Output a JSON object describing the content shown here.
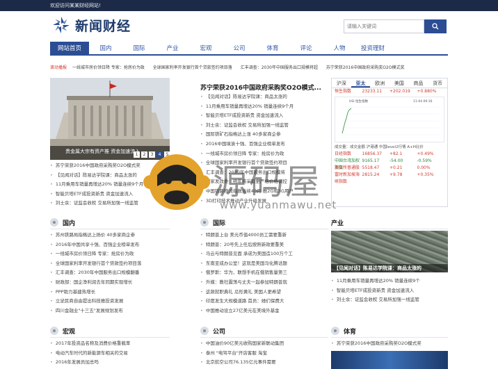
{
  "topbar": {
    "welcome": "欢迎访问某某财经网站!"
  },
  "header": {
    "logo_text": "新闻财经",
    "logo_icon": "pinwheel-logo",
    "search_placeholder": "请输入关键词",
    "search_icon": "magnifier-icon"
  },
  "nav": {
    "items": [
      "网站首页",
      "国内",
      "国际",
      "产业",
      "宏观",
      "公司",
      "体育",
      "评论",
      "人物",
      "投资理财"
    ]
  },
  "ticker": {
    "label": "滚动播报",
    "items": [
      "一线城市房价领日降 专家：抢房价为政",
      "全球国家利率开发银行首个贷款签约项目落",
      "汇丰调查：2030年中国服务出口规模将超",
      "苏宁荣获2016中国政府采购奖O2O模式奖"
    ]
  },
  "hero": {
    "caption": "贵金属大宗有资产推 资金加速流入",
    "pages": [
      "1",
      "2",
      "3",
      "4",
      "5"
    ],
    "active_page": 4
  },
  "col1_list": [
    "苏宁荣获2016中国政府采购奖O2O模式奖",
    "【见闻对话】陈易达学院课：商品太涨的",
    "11月乘用车销量再增达20% 销量连续9个月",
    "智能贝塔ETF成投资新贵 资金加速流入",
    "刘士余：证监会收权 交易所加强一线监管"
  ],
  "headline": "苏宁荣获2016中国政府采购奖O2O模式...",
  "col2_list": [
    "【见闻对话】陈易达学院课：商品太涨的",
    "11月乘用车销量再增达20% 销量连续9个月",
    "智能贝塔ETF成投资新贵 资金加速流入",
    "刘士余：证监会收权 交易所加强一线监管",
    "国际铁矿石指格达上涨 40多家商企参",
    "2016中国境诶十强、百强企业榜单发布",
    "一线城市房价领日降 专家：抢房价为政",
    "全球国家利率开发银行首个贷款签约项目",
    "汇丰调查：2030年中国服务出口规模将",
    "国家发改委：明年将采取更严格价格调控",
    "中国铁路物流指数连续40月 推2G和3G用户",
    "3D打印技术推动产业升级发展"
  ],
  "market": {
    "tabs": [
      "沪深",
      "亚太",
      "欧洲",
      "美国",
      "商品",
      "货币"
    ],
    "active_tab": 1,
    "top_row": {
      "name": "恒生指数",
      "value": "23233.11",
      "change": "+202.019",
      "pct": "+0.880%"
    },
    "chart_title": "HSI 恒生指数",
    "chart_time": "11-04 09:16",
    "note": "成交量：成交金额 沪港通 中国level2行情 A+H比价",
    "rows": [
      {
        "name": "日经指数",
        "value": "16856.37",
        "change": "+82.1",
        "pct": "+0.49%",
        "dir": "up"
      },
      {
        "name": "中国台湾加权指数",
        "value": "9165.17",
        "change": "-54.00",
        "pct": "-0.59%",
        "dir": "down"
      },
      {
        "name": "澳交所普通股",
        "value": "5518.47",
        "change": "+0.21",
        "pct": "0.00%",
        "dir": "up"
      },
      {
        "name": "富时新加坡海峡指数",
        "value": "2815.24",
        "change": "+9.78",
        "pct": "+0.35%",
        "dir": "up"
      }
    ]
  },
  "sections": {
    "domestic": {
      "title": "国内",
      "items": [
        "苏州铁路局指格达上扬价 40多家商企参",
        "2016年中国共享十强、百强企业榜单发布",
        "一线城市房价领日降 专家：抢房价为政",
        "全球国家利率开发银行首个贷款签约项目落",
        "汇丰调查：2030年中国服务出口规模翻番",
        "财政部：国企净利润去年同期实现增长",
        "PPP助力基建热增长",
        "立足民商自由提出科技推投资发展",
        "四川金融业\"十三五\"发展规划发布"
      ]
    },
    "international": {
      "title": "国际",
      "items": [
        "特朗普上台 美元币值4000员工需要重新",
        "特朗普：20号先上任后按照新政要重美",
        "马云与特朗普见面 承诺为美国造100万个工",
        "东南亚成办公室！这就是美国马化腾话题",
        "俄罗斯：华为、联想手机在俄销售量第三",
        "外媒：教社震荡与丈夫一起参加特朗普就",
        "这款就职典礼 瓜形黄礼 美国人更希望",
        "印度发生大规模道路 首员：她们保费大",
        "中国推动设立27亿美元在美境外基金"
      ]
    },
    "industry": {
      "title": "产业",
      "image_caption": "【见闻对话】陈易达学院课：商品太涨的",
      "items": [
        "11月乘用车销量再增达20% 销量连续9个",
        "智能贝塔ETF成投资新贵 资金加速流入",
        "刘士余：证监会收权 交易所加强一线监管"
      ]
    },
    "macro": {
      "title": "宏观",
      "items": [
        "2017年投资品名称及消费价格重载率",
        "电动汽车时代的新能源车相关的交易",
        "2016年发展员加总吗"
      ]
    },
    "company": {
      "title": "公司",
      "items": [
        "中国油价90亿美元收购国家新联动集团",
        "泰州 \"电驾平台\"开店客服 淘宝",
        "北京航空公司76.135亿元事件需要"
      ]
    },
    "sports": {
      "title": "体育",
      "items": [
        "苏宁荣获2016中国政府采购奖O2O模式奖"
      ]
    }
  },
  "watermark": {
    "text": "源码屋",
    "url": "www.yuanmawu.net"
  },
  "colors": {
    "brand": "#2c4d94",
    "topbar": "#1d2a47",
    "up": "#d13a2f",
    "down": "#2b8a3e"
  }
}
